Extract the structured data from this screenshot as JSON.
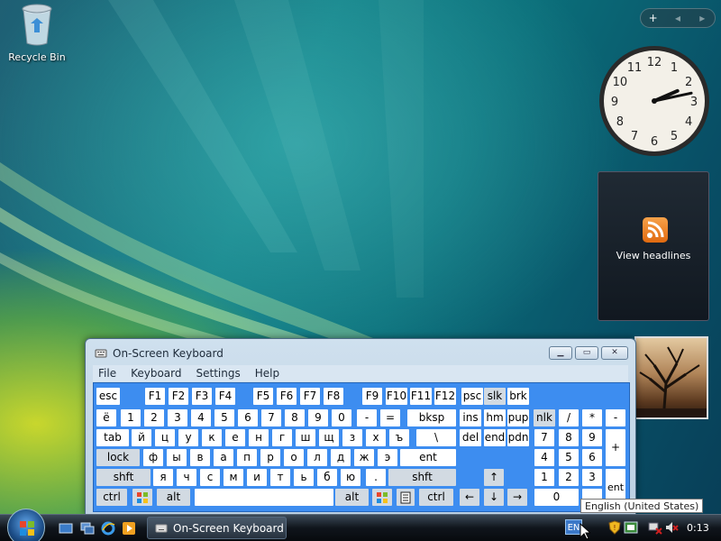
{
  "desktop": {
    "recycle_bin_label": "Recycle Bin"
  },
  "sidebar": {
    "add_label": "+",
    "prev_label": "◂",
    "next_label": "▸"
  },
  "clock": {
    "numbers": [
      "12",
      "1",
      "2",
      "3",
      "4",
      "5",
      "6",
      "7",
      "8",
      "9",
      "10",
      "11"
    ],
    "hour": 2,
    "minute": 13
  },
  "feed_gadget": {
    "label": "View headlines",
    "icon": "rss-icon"
  },
  "window": {
    "title": "On-Screen Keyboard",
    "menu": [
      "File",
      "Keyboard",
      "Settings",
      "Help"
    ],
    "buttons": {
      "minimize": "▁",
      "maximize": "▭",
      "close": "✕"
    }
  },
  "keyboard": {
    "keys": [
      "esc",
      "F1",
      "F2",
      "F3",
      "F4",
      "F5",
      "F6",
      "F7",
      "F8",
      "F9",
      "F10",
      "F11",
      "F12",
      "ë",
      "1",
      "2",
      "3",
      "4",
      "5",
      "6",
      "7",
      "8",
      "9",
      "0",
      "-",
      "=",
      "bksp",
      "tab",
      "й",
      "ц",
      "у",
      "к",
      "е",
      "н",
      "г",
      "ш",
      "щ",
      "з",
      "х",
      "ъ",
      "\\",
      "lock",
      "ф",
      "ы",
      "в",
      "а",
      "п",
      "р",
      "о",
      "л",
      "д",
      "ж",
      "э",
      "ent",
      "shft",
      "я",
      "ч",
      "с",
      "м",
      "и",
      "т",
      "ь",
      "б",
      "ю",
      ".",
      "shft",
      "ctrl",
      "alt",
      "alt",
      "ctrl",
      "psc",
      "slk",
      "brk",
      "ins",
      "hm",
      "pup",
      "del",
      "end",
      "pdn",
      "↑",
      "←",
      "↓",
      "→",
      "nlk",
      "/",
      "*",
      "-",
      "7",
      "8",
      "9",
      "+",
      "4",
      "5",
      "6",
      "1",
      "2",
      "3",
      "ent",
      "0",
      "."
    ]
  },
  "taskbar": {
    "task_label": "On-Screen Keyboard",
    "language": "EN",
    "time": "0:13",
    "tooltip": "English (United States)"
  },
  "colors": {
    "keyboard_bg": "#3d8df0",
    "key_white": "#ffffff",
    "key_gray": "#d2dae2"
  }
}
